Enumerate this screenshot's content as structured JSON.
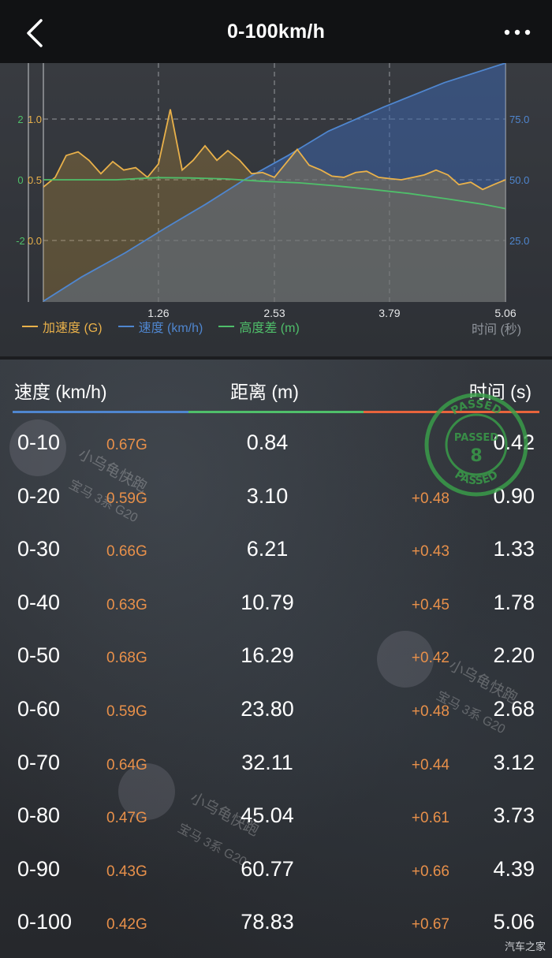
{
  "header": {
    "title": "0-100km/h"
  },
  "chart_data": {
    "type": "line",
    "x_ticks": [
      "1.26",
      "2.53",
      "3.79",
      "5.06"
    ],
    "xlim": [
      0,
      5.06
    ],
    "x_unit_label": "时间 (秒)",
    "left_axis_outer_ticks": [
      "2",
      "0",
      "-2"
    ],
    "left_axis_inner_ticks": [
      "1.0",
      "0.5",
      "0.0"
    ],
    "right_axis_ticks": [
      "75.0",
      "50.0",
      "25.0"
    ],
    "series": [
      {
        "name": "加速度 (G)",
        "color": "#e9b14a",
        "axis": "left",
        "x": [
          0,
          0.13,
          0.25,
          0.38,
          0.5,
          0.63,
          0.76,
          0.88,
          1.01,
          1.14,
          1.26,
          1.39,
          1.52,
          1.64,
          1.77,
          1.9,
          2.02,
          2.15,
          2.28,
          2.4,
          2.53,
          2.66,
          2.78,
          2.91,
          3.04,
          3.16,
          3.29,
          3.42,
          3.54,
          3.67,
          3.79,
          3.92,
          4.05,
          4.17,
          4.3,
          4.43,
          4.55,
          4.68,
          4.81,
          4.93,
          5.06
        ],
        "y": [
          0.44,
          0.52,
          0.7,
          0.73,
          0.66,
          0.55,
          0.65,
          0.58,
          0.6,
          0.52,
          0.63,
          1.08,
          0.58,
          0.66,
          0.78,
          0.66,
          0.74,
          0.66,
          0.55,
          0.56,
          0.52,
          0.64,
          0.75,
          0.62,
          0.58,
          0.53,
          0.52,
          0.56,
          0.57,
          0.52,
          0.51,
          0.5,
          0.52,
          0.54,
          0.58,
          0.54,
          0.46,
          0.48,
          0.42,
          0.46,
          0.5
        ]
      },
      {
        "name": "速度 (km/h)",
        "color": "#4f86cf",
        "axis": "right",
        "x": [
          0,
          0.42,
          0.9,
          1.33,
          1.78,
          2.2,
          2.68,
          3.12,
          3.73,
          4.39,
          5.06
        ],
        "y": [
          0,
          10,
          20,
          30,
          40,
          50,
          60,
          70,
          80,
          90,
          100
        ]
      },
      {
        "name": "高度差 (m)",
        "color": "#4fbf6a",
        "axis": "left",
        "x": [
          0,
          0.4,
          0.8,
          1.1,
          1.26,
          1.6,
          2.0,
          2.4,
          2.8,
          3.2,
          3.6,
          4.0,
          4.4,
          4.8,
          5.06
        ],
        "y": [
          0,
          0,
          0,
          0.05,
          0.07,
          0.06,
          0.03,
          -0.05,
          -0.1,
          -0.2,
          -0.32,
          -0.45,
          -0.62,
          -0.8,
          -0.95
        ]
      }
    ]
  },
  "table": {
    "headers": {
      "speed": "速度 (km/h)",
      "distance": "距离 (m)",
      "time": "时间 (s)"
    },
    "header_line_colors": [
      "#4f86cf",
      "#4fbf6a",
      "#e8643c"
    ],
    "rows": [
      {
        "speed": "0-10",
        "g": "0.67G",
        "dist": "0.84",
        "delta": "",
        "time": "0.42"
      },
      {
        "speed": "0-20",
        "g": "0.59G",
        "dist": "3.10",
        "delta": "+0.48",
        "time": "0.90"
      },
      {
        "speed": "0-30",
        "g": "0.66G",
        "dist": "6.21",
        "delta": "+0.43",
        "time": "1.33"
      },
      {
        "speed": "0-40",
        "g": "0.63G",
        "dist": "10.79",
        "delta": "+0.45",
        "time": "1.78"
      },
      {
        "speed": "0-50",
        "g": "0.68G",
        "dist": "16.29",
        "delta": "+0.42",
        "time": "2.20"
      },
      {
        "speed": "0-60",
        "g": "0.59G",
        "dist": "23.80",
        "delta": "+0.48",
        "time": "2.68"
      },
      {
        "speed": "0-70",
        "g": "0.64G",
        "dist": "32.11",
        "delta": "+0.44",
        "time": "3.12"
      },
      {
        "speed": "0-80",
        "g": "0.47G",
        "dist": "45.04",
        "delta": "+0.61",
        "time": "3.73"
      },
      {
        "speed": "0-90",
        "g": "0.43G",
        "dist": "60.77",
        "delta": "+0.66",
        "time": "4.39"
      },
      {
        "speed": "0-100",
        "g": "0.42G",
        "dist": "78.83",
        "delta": "+0.67",
        "time": "5.06"
      }
    ]
  },
  "stamp": {
    "text_ring": "PASSED",
    "center_text": "PASSED",
    "number": "8",
    "color": "#3aa04a"
  },
  "watermarks": {
    "line1": "小乌龟快跑",
    "line2": "宝马 3系 G20"
  },
  "credit": "汽车之家"
}
